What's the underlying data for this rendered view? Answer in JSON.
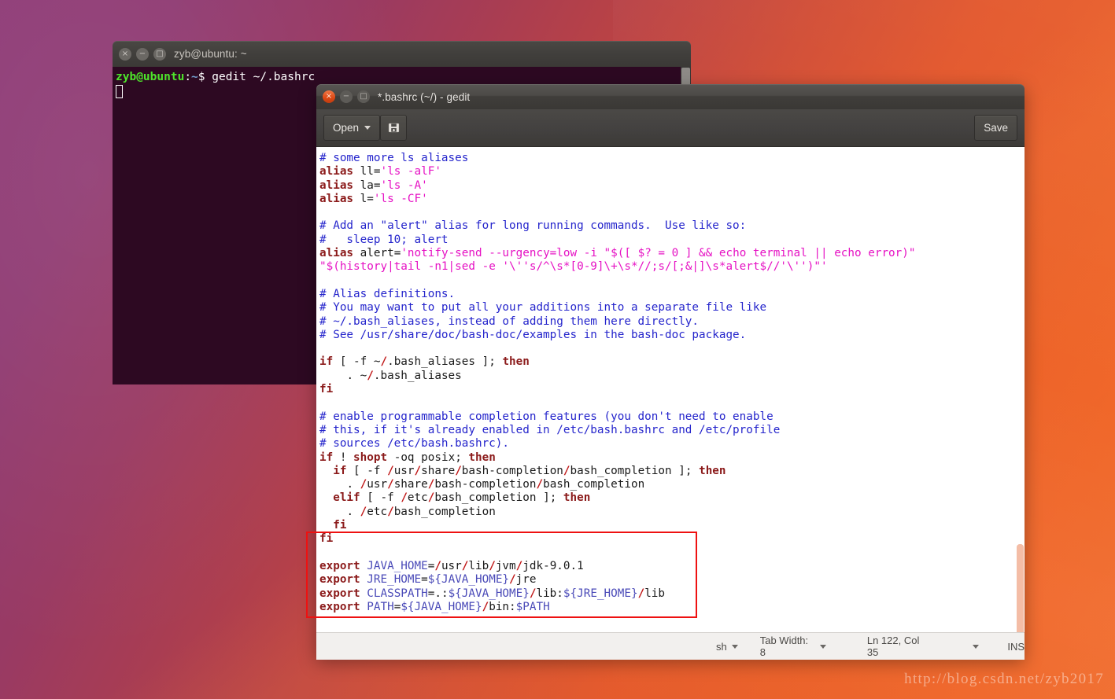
{
  "desktop": {
    "watermark": "http://blog.csdn.net/zyb2017",
    "colors": {
      "purple": "#8e3a76",
      "orange": "#ef6327"
    }
  },
  "terminal": {
    "title": "zyb@ubuntu: ~",
    "prompt_user": "zyb@ubuntu",
    "prompt_colon": ":",
    "prompt_path": "~",
    "prompt_command": "$ gedit ~/.bashrc",
    "window_buttons": {
      "close": "×",
      "minimize": "−",
      "maximize": "□"
    }
  },
  "gedit": {
    "title": "*.bashrc (~/) - gedit",
    "window_buttons": {
      "close": "×",
      "minimize": "−",
      "maximize": "□"
    },
    "toolbar": {
      "open_label": "Open",
      "newdoc_icon": "save-as-icon",
      "save_label": "Save"
    },
    "statusbar": {
      "language": "sh",
      "tab_width": "Tab Width: 8",
      "position": "Ln 122, Col 35",
      "mode": "INS"
    },
    "document_text": [
      "# some more ls aliases",
      "alias ll='ls -alF'",
      "alias la='ls -A'",
      "alias l='ls -CF'",
      "",
      "# Add an \"alert\" alias for long running commands.  Use like so:",
      "#   sleep 10; alert",
      "alias alert='notify-send --urgency=low -i \"$([ $? = 0 ] && echo terminal || echo error)\"",
      "\"$(history|tail -n1|sed -e '\\''s/^\\s*[0-9]\\+\\s*//;s/[;&|]\\s*alert$//'\\'')\"'",
      "",
      "# Alias definitions.",
      "# You may want to put all your additions into a separate file like",
      "# ~/.bash_aliases, instead of adding them here directly.",
      "# See /usr/share/doc/bash-doc/examples in the bash-doc package.",
      "",
      "if [ -f ~/.bash_aliases ]; then",
      "    . ~/.bash_aliases",
      "fi",
      "",
      "# enable programmable completion features (you don't need to enable",
      "# this, if it's already enabled in /etc/bash.bashrc and /etc/profile",
      "# sources /etc/bash.bashrc).",
      "if ! shopt -oq posix; then",
      "  if [ -f /usr/share/bash-completion/bash_completion ]; then",
      "    . /usr/share/bash-completion/bash_completion",
      "  elif [ -f /etc/bash_completion ]; then",
      "    . /etc/bash_completion",
      "  fi",
      "fi",
      "",
      "export JAVA_HOME=/usr/lib/jvm/jdk-9.0.1",
      "export JRE_HOME=${JAVA_HOME}/jre",
      "export CLASSPATH=.:${JAVA_HOME}/lib:${JRE_HOME}/lib",
      "export PATH=${JAVA_HOME}/bin:$PATH"
    ],
    "annotation": {
      "color": "#ee1111",
      "encloses": "java environment export lines"
    }
  }
}
